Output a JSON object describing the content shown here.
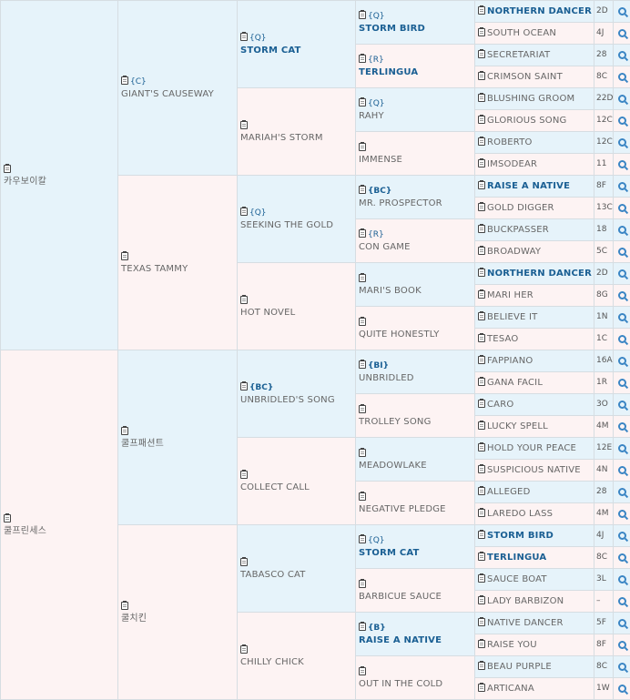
{
  "gen1": [
    {
      "name": "카우보이칼"
    },
    {
      "name": "쿨프린세스"
    }
  ],
  "gen2": [
    {
      "tag": "{C}",
      "name": "GIANT'S CAUSEWAY"
    },
    {
      "tag": "",
      "name": "TEXAS TAMMY"
    },
    {
      "tag": "",
      "name": "쿨프패션트"
    },
    {
      "tag": "",
      "name": "쿨치킨"
    }
  ],
  "gen3": [
    {
      "tag": "{Q}",
      "name": "STORM CAT",
      "bold": true
    },
    {
      "tag": "",
      "name": "MARIAH'S STORM"
    },
    {
      "tag": "{Q}",
      "name": "SEEKING THE GOLD"
    },
    {
      "tag": "",
      "name": "HOT NOVEL"
    },
    {
      "tag": "{BC}",
      "name": "UNBRIDLED'S SONG",
      "tagBold": true
    },
    {
      "tag": "",
      "name": "COLLECT CALL"
    },
    {
      "tag": "",
      "name": "TABASCO CAT"
    },
    {
      "tag": "",
      "name": "CHILLY CHICK"
    }
  ],
  "gen4": [
    {
      "tag": "{Q}",
      "name": "STORM BIRD",
      "bold": true
    },
    {
      "tag": "{R}",
      "name": "TERLINGUA",
      "bold": true
    },
    {
      "tag": "{Q}",
      "name": "RAHY"
    },
    {
      "tag": "",
      "name": "IMMENSE"
    },
    {
      "tag": "{BC}",
      "name": "MR. PROSPECTOR",
      "tagBold": true
    },
    {
      "tag": "{R}",
      "name": "CON GAME"
    },
    {
      "tag": "",
      "name": "MARI'S BOOK"
    },
    {
      "tag": "",
      "name": "QUITE HONESTLY"
    },
    {
      "tag": "{BI}",
      "name": "UNBRIDLED",
      "tagBold": true
    },
    {
      "tag": "",
      "name": "TROLLEY SONG"
    },
    {
      "tag": "",
      "name": "MEADOWLAKE"
    },
    {
      "tag": "",
      "name": "NEGATIVE PLEDGE"
    },
    {
      "tag": "{Q}",
      "name": "STORM CAT",
      "bold": true
    },
    {
      "tag": "",
      "name": "BARBICUE SAUCE"
    },
    {
      "tag": "{B}",
      "name": "RAISE A NATIVE",
      "bold": true,
      "tagBold": true
    },
    {
      "tag": "",
      "name": "OUT IN THE COLD"
    }
  ],
  "gen5": [
    {
      "name": "NORTHERN DANCER",
      "count": "2D",
      "bold": true
    },
    {
      "name": "SOUTH OCEAN",
      "count": "4J"
    },
    {
      "name": "SECRETARIAT",
      "count": "28"
    },
    {
      "name": "CRIMSON SAINT",
      "count": "8C"
    },
    {
      "name": "BLUSHING GROOM",
      "count": "22D"
    },
    {
      "name": "GLORIOUS SONG",
      "count": "12C"
    },
    {
      "name": "ROBERTO",
      "count": "12C"
    },
    {
      "name": "IMSODEAR",
      "count": "11"
    },
    {
      "name": "RAISE A NATIVE",
      "count": "8F",
      "bold": true
    },
    {
      "name": "GOLD DIGGER",
      "count": "13C"
    },
    {
      "name": "BUCKPASSER",
      "count": "18"
    },
    {
      "name": "BROADWAY",
      "count": "5C"
    },
    {
      "name": "NORTHERN DANCER",
      "count": "2D",
      "bold": true
    },
    {
      "name": "MARI HER",
      "count": "8G"
    },
    {
      "name": "BELIEVE IT",
      "count": "1N"
    },
    {
      "name": "TESAO",
      "count": "1C"
    },
    {
      "name": "FAPPIANO",
      "count": "16A"
    },
    {
      "name": "GANA FACIL",
      "count": "1R"
    },
    {
      "name": "CARO",
      "count": "3O"
    },
    {
      "name": "LUCKY SPELL",
      "count": "4M"
    },
    {
      "name": "HOLD YOUR PEACE",
      "count": "12E"
    },
    {
      "name": "SUSPICIOUS NATIVE",
      "count": "4N"
    },
    {
      "name": "ALLEGED",
      "count": "28"
    },
    {
      "name": "LAREDO LASS",
      "count": "4M"
    },
    {
      "name": "STORM BIRD",
      "count": "4J",
      "bold": true
    },
    {
      "name": "TERLINGUA",
      "count": "8C",
      "bold": true
    },
    {
      "name": "SAUCE BOAT",
      "count": "3L"
    },
    {
      "name": "LADY BARBIZON",
      "count": "–"
    },
    {
      "name": "NATIVE DANCER",
      "count": "5F"
    },
    {
      "name": "RAISE YOU",
      "count": "8F"
    },
    {
      "name": "BEAU PURPLE",
      "count": "8C"
    },
    {
      "name": "ARTICANA",
      "count": "1W"
    }
  ]
}
